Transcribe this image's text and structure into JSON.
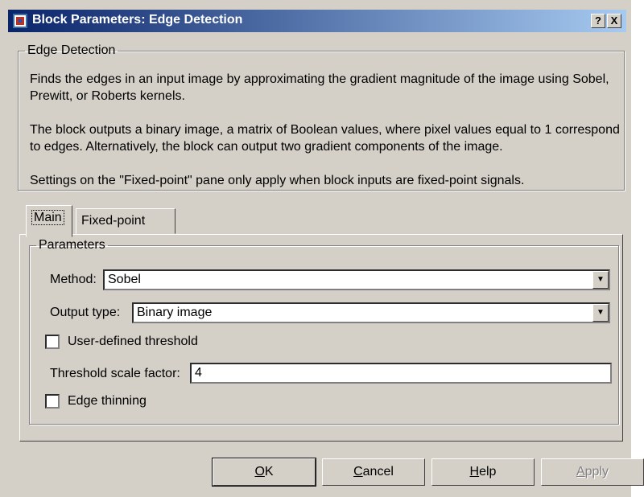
{
  "window": {
    "title": "Block Parameters: Edge Detection",
    "help_button_label": "?",
    "close_button_label": "X"
  },
  "description": {
    "group_label": "Edge Detection",
    "paragraphs": [
      "Finds the edges in an input image by approximating the gradient magnitude of the image using Sobel, Prewitt, or Roberts kernels.",
      "The block outputs a binary image, a matrix of Boolean values, where pixel values equal to 1 correspond to edges.  Alternatively, the block can output two gradient components of the image.",
      "Settings on the \"Fixed-point\" pane only apply when block inputs are fixed-point signals."
    ]
  },
  "tabs": [
    {
      "label": "Main",
      "active": true
    },
    {
      "label": "Fixed-point",
      "active": false
    }
  ],
  "parameters": {
    "group_label": "Parameters",
    "method": {
      "label": "Method:",
      "value": "Sobel"
    },
    "output_type": {
      "label": "Output type:",
      "value": "Binary image"
    },
    "user_threshold": {
      "label": "User-defined threshold",
      "checked": false
    },
    "threshold_scale": {
      "label": "Threshold scale factor:",
      "value": "4"
    },
    "edge_thinning": {
      "label": "Edge thinning",
      "checked": false
    }
  },
  "buttons": {
    "ok": {
      "mnemonic": "O",
      "rest": "K"
    },
    "cancel": {
      "mnemonic": "C",
      "rest": "ancel"
    },
    "help": {
      "mnemonic": "H",
      "rest": "elp"
    },
    "apply": {
      "mnemonic": "A",
      "rest": "pply"
    }
  },
  "colors": {
    "titlebar_start": "#0a246a",
    "titlebar_end": "#a6caf0",
    "face": "#d4d0c8"
  }
}
